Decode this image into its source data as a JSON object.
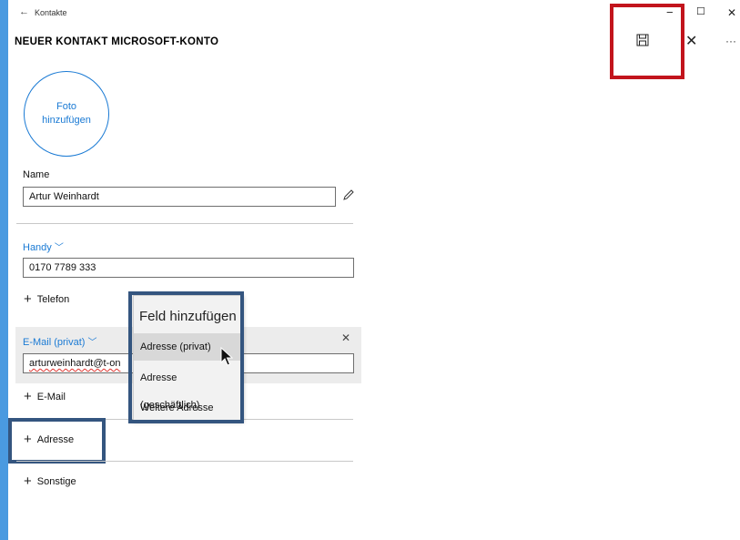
{
  "window": {
    "back_glyph": "←",
    "app_title": "Kontakte",
    "minimize_glyph": "−",
    "maximize_glyph": "☐",
    "close_glyph": "✕"
  },
  "header": {
    "title": "NEUER KONTAKT MICROSOFT-KONTO",
    "save_icon": "save-icon",
    "cancel_glyph": "✕",
    "more_glyph": "···"
  },
  "photo": {
    "label": "Foto hinzufügen"
  },
  "name": {
    "label": "Name",
    "value": "Artur Weinhardt",
    "edit_icon": "pencil-icon"
  },
  "phone": {
    "type_label": "Handy",
    "chevron": "﹀",
    "value": "0170 7789 333"
  },
  "add_phone": {
    "label": "Telefon"
  },
  "email": {
    "type_label": "E-Mail (privat)",
    "chevron": "﹀",
    "value": "arturweinhardt@t-on",
    "remove_glyph": "✕"
  },
  "add_email": {
    "label": "E-Mail"
  },
  "add_address": {
    "label": "Adresse"
  },
  "add_other": {
    "label": "Sonstige"
  },
  "plus_glyph": "+",
  "dropdown": {
    "title": "Feld hinzufügen",
    "items": [
      "Adresse (privat)",
      "Adresse (geschäftlich)",
      "Weitere Adresse"
    ]
  },
  "colors": {
    "accent": "#1a7ad4",
    "highlight_red": "#c2141c",
    "highlight_blue": "#34557f",
    "desktop": "#4a9ae0"
  }
}
